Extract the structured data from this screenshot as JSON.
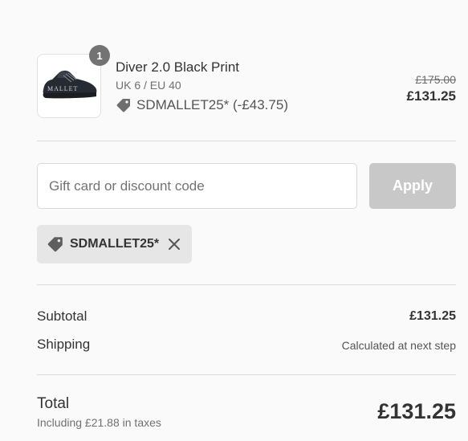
{
  "product": {
    "image_alt": "Diver 2.0 Black Print",
    "image_print_text": "MALLET",
    "quantity": "1",
    "name": "Diver 2.0 Black Print",
    "variant": "UK 6 / EU 40",
    "discount_line": "SDMALLET25* (-£43.75)",
    "compare_price": "£175.00",
    "price": "£131.25"
  },
  "discount_form": {
    "placeholder": "Gift card or discount code",
    "apply_label": "Apply",
    "applied_code": "SDMALLET25*"
  },
  "totals": {
    "subtotal_label": "Subtotal",
    "subtotal_value": "£131.25",
    "shipping_label": "Shipping",
    "shipping_value": "Calculated at next step",
    "total_label": "Total",
    "tax_note": "Including £21.88 in taxes",
    "total_value": "£131.25"
  },
  "icons": {
    "discount": "tag-icon",
    "remove": "close-icon"
  },
  "colors": {
    "apply_disabled": "#c8c8c8",
    "badge": "#737373",
    "chip_background": "#e6e6e6"
  }
}
